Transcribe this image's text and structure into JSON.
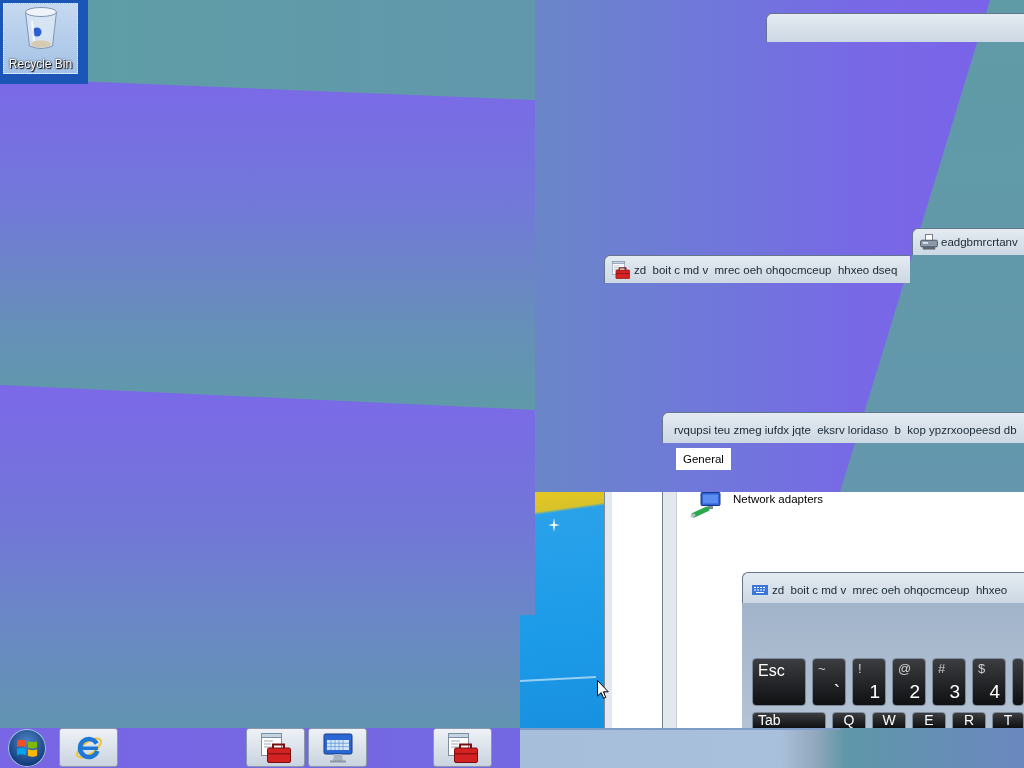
{
  "desktop_icons": [
    {
      "label": "Recycle Bin",
      "selected": true
    }
  ],
  "device_window": {
    "title": "zd  boit c md v  mrec oeh ohqocmceup  hhxeo dseq"
  },
  "fax_window": {
    "title": "eadgbmrcrtanv"
  },
  "properties_window": {
    "title": "rvqupsi teu zmeg iufdx jqte  eksrv loridaso  b  kop ypzrxoopeesd db",
    "tabs": [
      {
        "label": "General",
        "selected": true
      }
    ],
    "items": [
      {
        "label": "Network adapters"
      }
    ]
  },
  "keyboard_window": {
    "title": "zd  boit c md v  mrec oeh ohqocmceup  hhxeo",
    "rows": [
      [
        {
          "kind": "named",
          "label": "Esc"
        },
        {
          "kind": "dual",
          "shift": "~",
          "main": "`"
        },
        {
          "kind": "dual",
          "shift": "!",
          "main": "1"
        },
        {
          "kind": "dual",
          "shift": "@",
          "main": "2"
        },
        {
          "kind": "dual",
          "shift": "#",
          "main": "3"
        },
        {
          "kind": "dual",
          "shift": "$",
          "main": "4"
        },
        {
          "kind": "blank"
        }
      ],
      [
        {
          "kind": "wide",
          "label": "Tab"
        },
        {
          "kind": "letter",
          "label": "Q"
        },
        {
          "kind": "letter",
          "label": "W"
        },
        {
          "kind": "letter",
          "label": "E"
        },
        {
          "kind": "letter",
          "label": "R"
        },
        {
          "kind": "letter",
          "label": "T"
        }
      ]
    ]
  },
  "taskbar": {
    "buttons": [
      {
        "kind": "start"
      },
      {
        "kind": "browser"
      },
      {
        "kind": "toolbox"
      },
      {
        "kind": "keyboard"
      },
      {
        "kind": "toolbox"
      }
    ]
  }
}
